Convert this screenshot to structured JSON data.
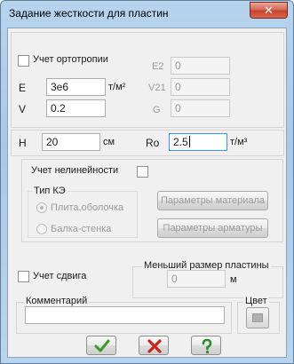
{
  "window": {
    "title": "Задание жесткости для пластин",
    "close_glyph": "✕"
  },
  "orthotropy": {
    "checkbox_label": "Учет ортотропии",
    "E_label": "E",
    "E_value": "3e6",
    "E_unit": "т/м²",
    "V_label": "V",
    "V_value": "0.2",
    "E2_label": "E2",
    "E2_value": "0",
    "V21_label": "V21",
    "V21_value": "0",
    "G_label": "G",
    "G_value": "0"
  },
  "thickness": {
    "H_label": "H",
    "H_value": "20",
    "H_unit": "см",
    "Ro_label": "Ro",
    "Ro_value": "2.5",
    "Ro_unit": "т/м³"
  },
  "nonlinearity": {
    "checkbox_label": "Учет нелинейности",
    "fe_type_label": "Тип КЭ",
    "radio_plate": "Плита,оболочка",
    "radio_beam_wall": "Балка-стенка",
    "material_params_button": "Параметры материала",
    "rebar_params_button": "Параметры арматуры"
  },
  "shear": {
    "checkbox_label": "Учет сдвига"
  },
  "min_size": {
    "label": "Меньший размер пластины",
    "value": "0",
    "unit": "м"
  },
  "comment": {
    "label": "Комментарий",
    "value": ""
  },
  "color": {
    "label": "Цвет",
    "swatch": "#b0b0b0"
  },
  "buttons": {
    "ok_icon": "check-icon",
    "cancel_icon": "cross-icon",
    "help_icon": "question-icon",
    "ok_color": "#3a9a2a",
    "cancel_color": "#c8261c",
    "help_color": "#2f8a2a"
  }
}
